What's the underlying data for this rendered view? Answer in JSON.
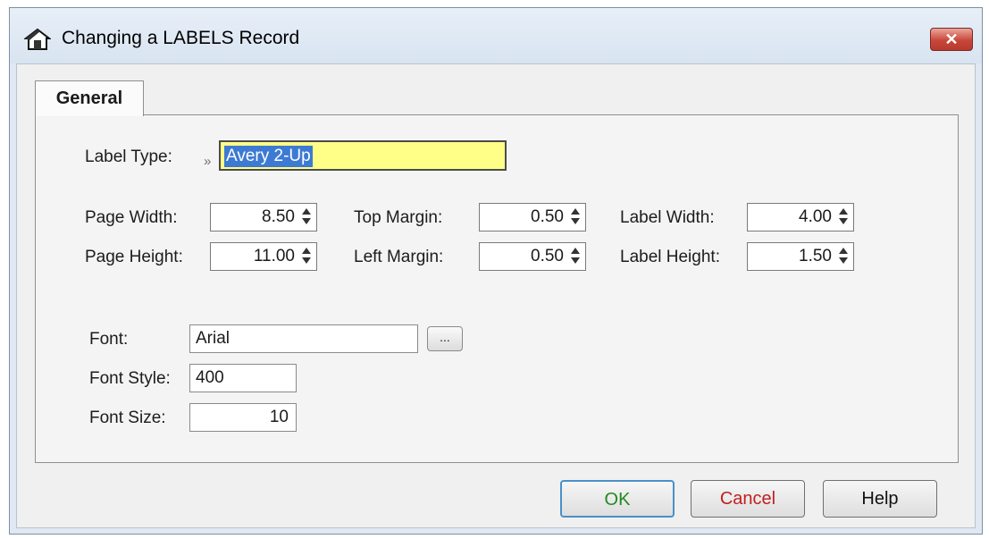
{
  "window": {
    "title": "Changing a LABELS Record",
    "close_label": "✕"
  },
  "tabs": [
    {
      "label": "General"
    }
  ],
  "label_type": {
    "label": "Label Type:",
    "marker": "»",
    "value": "Avery 2-Up"
  },
  "spinners": {
    "page_width": {
      "label": "Page Width:",
      "value": "8.50"
    },
    "page_height": {
      "label": "Page Height:",
      "value": "11.00"
    },
    "top_margin": {
      "label": "Top Margin:",
      "value": "0.50"
    },
    "left_margin": {
      "label": "Left Margin:",
      "value": "0.50"
    },
    "label_width": {
      "label": "Label Width:",
      "value": "4.00"
    },
    "label_height": {
      "label": "Label Height:",
      "value": "1.50"
    }
  },
  "font": {
    "font_label": "Font:",
    "font_value": "Arial",
    "browse_label": "...",
    "style_label": "Font Style:",
    "style_value": "400",
    "size_label": "Font Size:",
    "size_value": "10"
  },
  "buttons": {
    "ok": "OK",
    "cancel": "Cancel",
    "help": "Help"
  },
  "colors": {
    "highlight": "#ffff88",
    "ok_text": "#208a20",
    "cancel_text": "#c02020"
  }
}
